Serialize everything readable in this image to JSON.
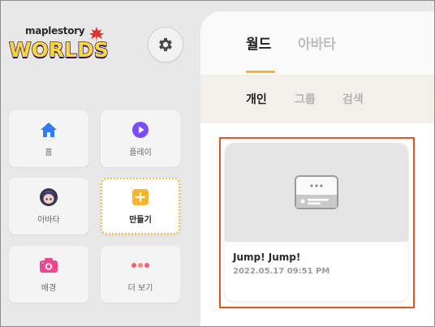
{
  "logo": {
    "sub_text": "maplestory",
    "main_text": "WORLDS"
  },
  "settings": {
    "icon": "gear-icon"
  },
  "nav": {
    "items": [
      {
        "label": "홈",
        "icon": "home-icon",
        "color": "#2f7df6"
      },
      {
        "label": "플레이",
        "icon": "play-icon",
        "color": "#7b4bff"
      },
      {
        "label": "아바타",
        "icon": "avatar-icon",
        "color": "#5a4f8a"
      },
      {
        "label": "만들기",
        "icon": "create-plus-icon",
        "color": "#f7b52b",
        "active": true
      },
      {
        "label": "배경",
        "icon": "camera-icon",
        "color": "#f0458f"
      },
      {
        "label": "더 보기",
        "icon": "more-dots-icon",
        "color": "#ff6b6b"
      }
    ]
  },
  "main_tabs": [
    {
      "label": "월드",
      "active": true
    },
    {
      "label": "아바타",
      "active": false
    }
  ],
  "sub_tabs": [
    {
      "label": "개인",
      "active": true
    },
    {
      "label": "그룹",
      "active": false
    },
    {
      "label": "검색",
      "active": false
    }
  ],
  "worlds": [
    {
      "title": "Jump! Jump!",
      "date": "2022.05.17 09:51 PM",
      "thumbnail_icon": "world-placeholder-icon"
    }
  ],
  "colors": {
    "accent": "#f5b733",
    "highlight_border": "#e8531f"
  }
}
